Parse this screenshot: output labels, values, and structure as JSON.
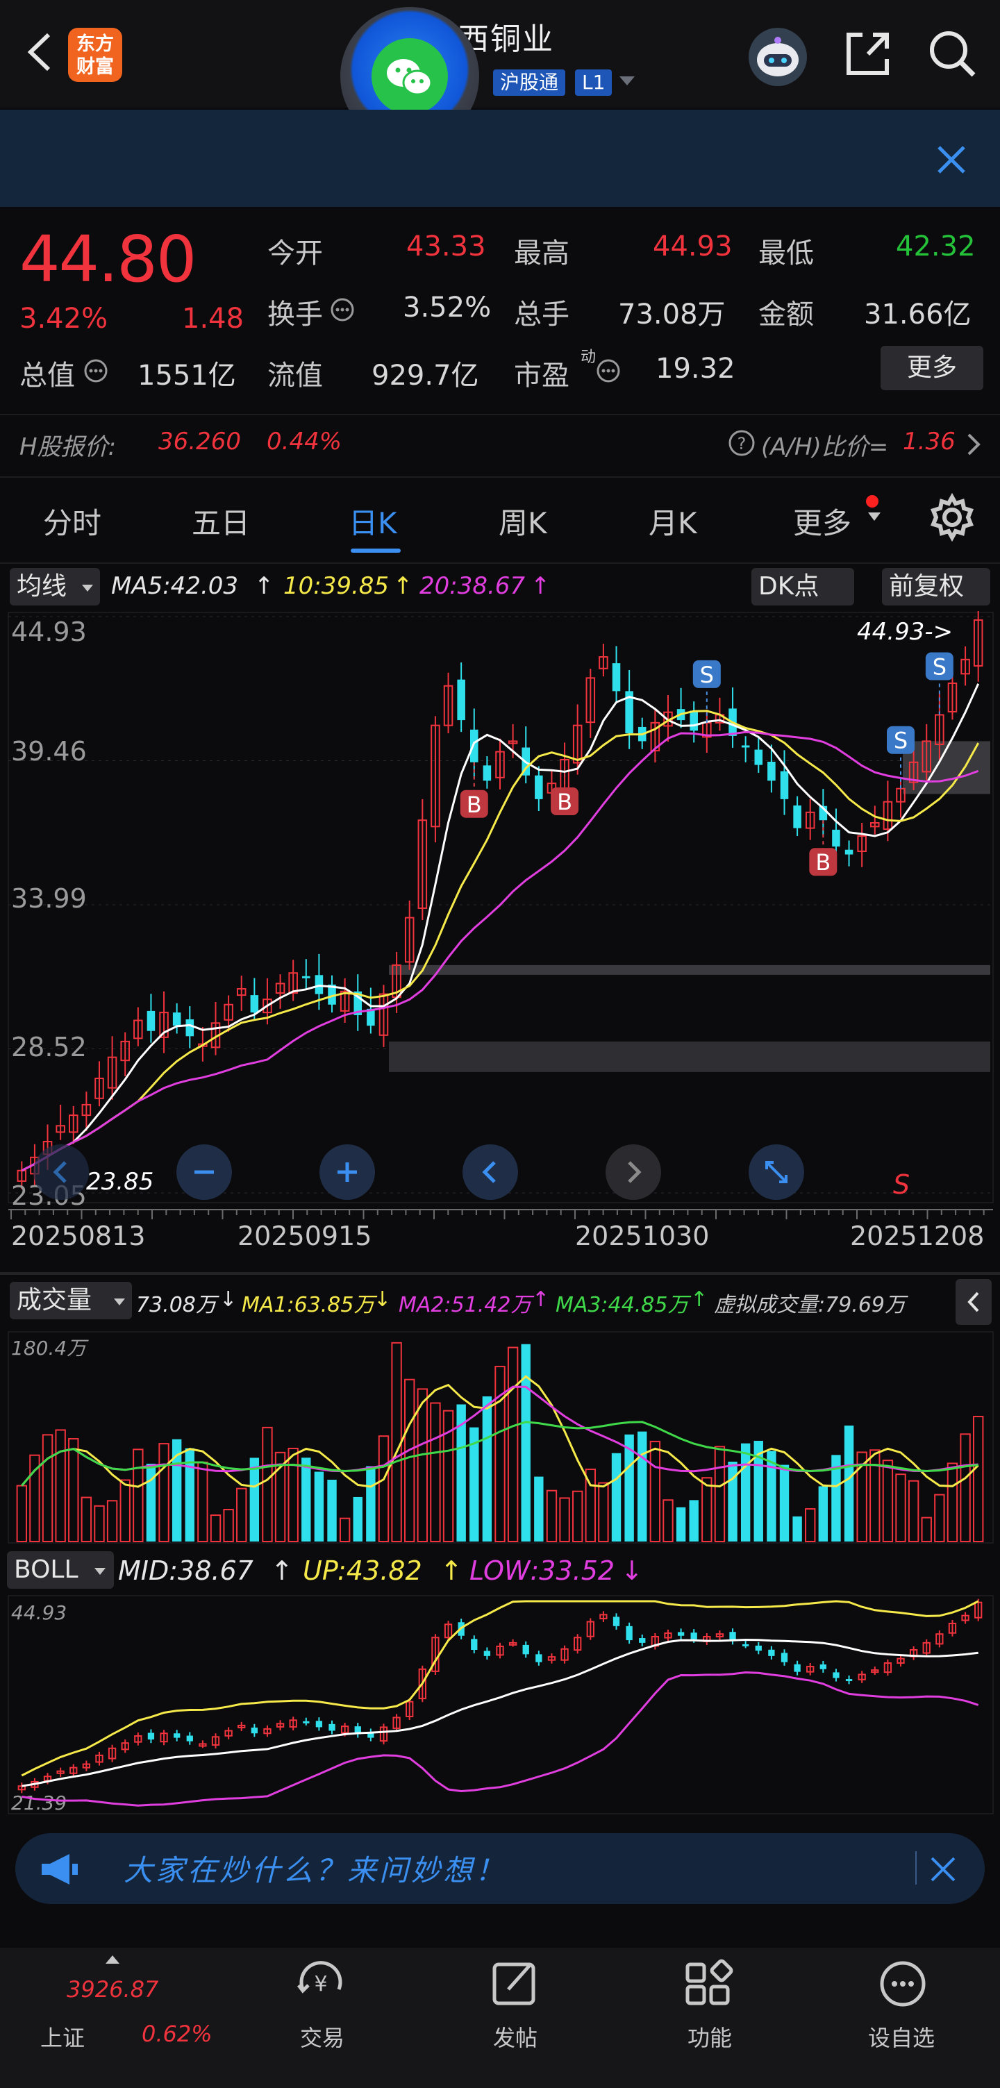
{
  "header": {
    "title": "西铜业",
    "brand": "东方财富",
    "tags": [
      "沪股通",
      "L1"
    ]
  },
  "quote": {
    "price": "44.80",
    "change_pct": "3.42%",
    "change_amt": "1.48",
    "open_label": "今开",
    "open": "43.33",
    "high_label": "最高",
    "high": "44.93",
    "low_label": "最低",
    "low": "42.32",
    "turnover_label": "换手",
    "turnover": "3.52%",
    "volume_label": "总手",
    "volume": "73.08万",
    "amount_label": "金额",
    "amount": "31.66亿",
    "mktcap_label": "总值",
    "mktcap": "1551亿",
    "float_label": "流值",
    "float": "929.7亿",
    "pe_label": "市盈",
    "pe_sup": "动",
    "pe": "19.32",
    "more": "更多"
  },
  "hshare": {
    "label": "H股报价:",
    "price": "36.260",
    "pct": "0.44%",
    "ratio_label": "(A/H)比价=",
    "ratio": "1.36"
  },
  "tabs": [
    "分时",
    "五日",
    "日K",
    "周K",
    "月K",
    "更多"
  ],
  "toolbar": {
    "ma_select": "均线",
    "ma5": "MA5:42.03",
    "ma10": "10:39.85",
    "ma20": "20:38.67",
    "dk": "DK点",
    "fq": "前复权"
  },
  "chart_data": [
    {
      "type": "candlestick",
      "yticks": [
        "44.93",
        "39.46",
        "33.99",
        "28.52",
        "23.05"
      ],
      "ylim": [
        23.05,
        44.93
      ],
      "x_ticks": [
        "20250813",
        "20250915",
        "20251030",
        "20251208"
      ],
      "annotations": [
        "44.93->",
        "23.85",
        "B",
        "S"
      ],
      "close_approx": [
        23.9,
        24.4,
        25.0,
        25.6,
        26.0,
        26.4,
        27.4,
        28.2,
        28.8,
        29.6,
        29.2,
        29.9,
        29.4,
        29.0,
        28.7,
        29.5,
        30.2,
        30.8,
        29.9,
        30.4,
        31.0,
        31.4,
        31.2,
        30.6,
        30.2,
        30.7,
        29.8,
        29.4,
        30.6,
        31.7,
        33.5,
        37.2,
        40.8,
        42.3,
        41.0,
        39.4,
        38.7,
        39.8,
        40.2,
        38.9,
        38.0,
        38.6,
        39.5,
        40.8,
        42.6,
        43.4,
        42.1,
        40.5,
        40.2,
        40.9,
        41.3,
        41.0,
        40.6,
        40.9,
        41.2,
        40.4,
        40.0,
        39.3,
        38.7,
        38.0,
        36.9,
        37.5,
        37.2,
        36.2,
        35.9,
        36.6,
        37.1,
        37.9,
        38.4,
        39.4,
        40.2,
        41.2,
        42.4,
        43.3,
        44.8
      ]
    },
    {
      "type": "bar",
      "title": "成交量",
      "vol": "73.08万",
      "ma1": "MA1:63.85万",
      "ma2": "MA2:51.42万",
      "ma3": "MA3:44.85万",
      "virtual": "虚拟成交量:79.69万",
      "ytop": "180.4万"
    },
    {
      "type": "line",
      "title": "BOLL",
      "mid": "MID:38.67",
      "up": "UP:43.82",
      "low": "LOW:33.52",
      "ytop": "44.93",
      "ybottom": "21.39"
    }
  ],
  "ai_bar": {
    "text": "大家在炒什么？来问妙想！"
  },
  "nav": {
    "index_value": "3926.87",
    "index_name": "上证",
    "index_pct": "0.62%",
    "items": [
      "交易",
      "发帖",
      "功能",
      "设自选"
    ]
  },
  "colors": {
    "up": "#f0333d",
    "down": "#2fe0ec",
    "accent": "#3a8ff0"
  }
}
